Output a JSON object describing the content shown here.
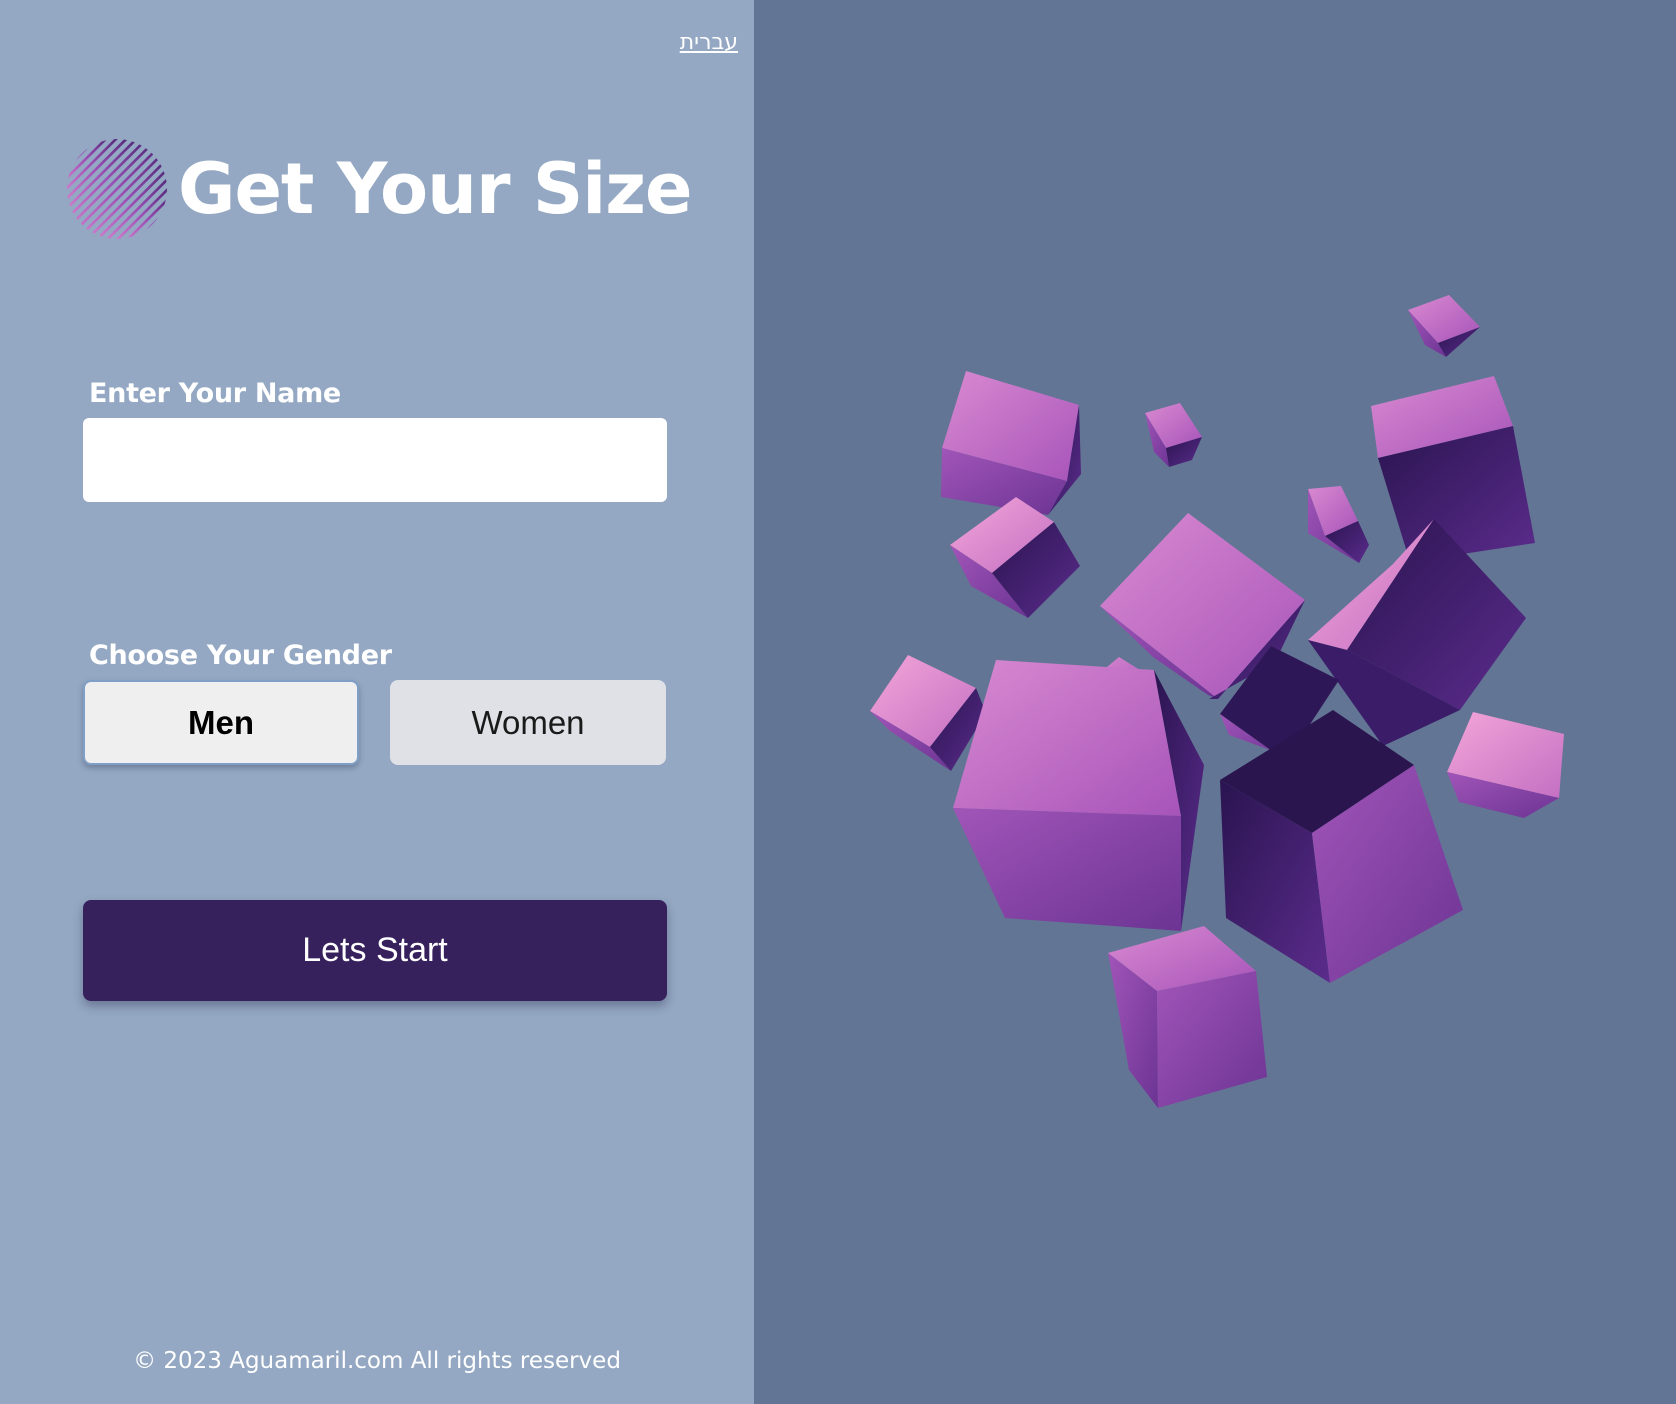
{
  "language_toggle": {
    "label": "עברית"
  },
  "header": {
    "title": "Get Your Size",
    "logo_icon": "striped-circle-logo-icon"
  },
  "name_field": {
    "label": "Enter Your Name",
    "value": "",
    "placeholder": ""
  },
  "gender": {
    "label": "Choose Your Gender",
    "options": [
      "Men",
      "Women"
    ],
    "selected": "Men"
  },
  "start_button": {
    "label": "Lets Start"
  },
  "footer": {
    "copyright": "© 2023 Aguamaril.com All rights reserved"
  },
  "hero_image": {
    "icon": "floating-purple-cubes-illustration"
  },
  "colors": {
    "left_panel_bg": "#94a8c3",
    "right_panel_bg": "#637594",
    "primary_button": "#37215d",
    "cube_light": "#e58ad0",
    "cube_mid": "#a04cb3",
    "cube_dark": "#3e1f6e"
  }
}
